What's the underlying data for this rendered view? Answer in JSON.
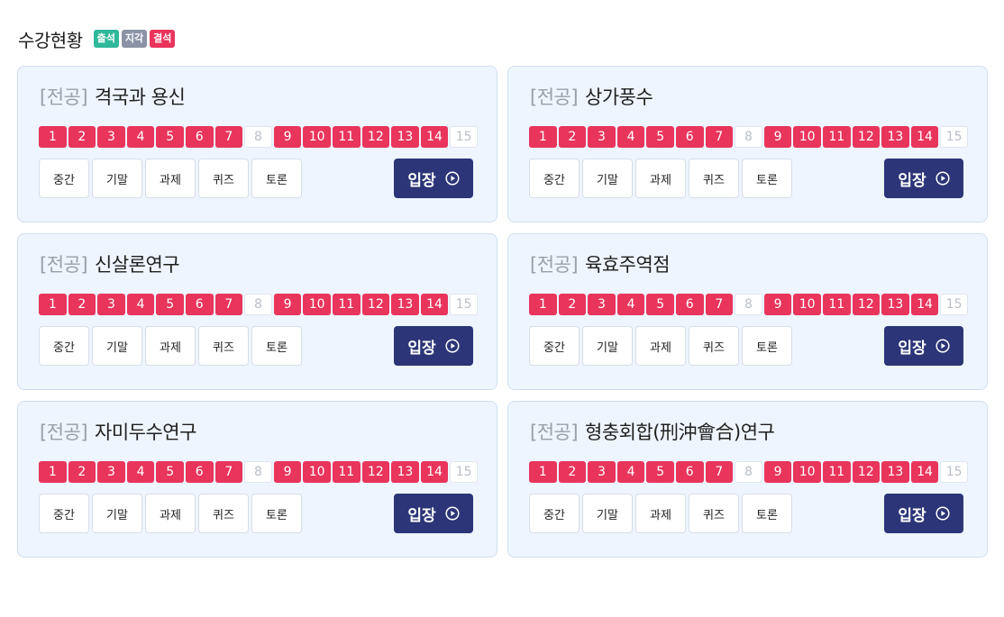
{
  "header": {
    "title": "수강현황",
    "legend": [
      {
        "label": "출석",
        "color": "#2fb89a"
      },
      {
        "label": "지각",
        "color": "#8b93a6"
      },
      {
        "label": "결석",
        "color": "#e9345b"
      }
    ]
  },
  "actions": [
    "중간",
    "기말",
    "과제",
    "퀴즈",
    "토론"
  ],
  "enter_label": "입장",
  "weeks": {
    "labels": [
      "1",
      "2",
      "3",
      "4",
      "5",
      "6",
      "7",
      "8",
      "9",
      "10",
      "11",
      "12",
      "13",
      "14",
      "15"
    ],
    "attended": [
      true,
      true,
      true,
      true,
      true,
      true,
      true,
      false,
      true,
      true,
      true,
      true,
      true,
      true,
      false
    ]
  },
  "courses": [
    {
      "category": "[전공]",
      "name": "격국과 용신"
    },
    {
      "category": "[전공]",
      "name": "상가풍수"
    },
    {
      "category": "[전공]",
      "name": "신살론연구"
    },
    {
      "category": "[전공]",
      "name": "육효주역점"
    },
    {
      "category": "[전공]",
      "name": "자미두수연구"
    },
    {
      "category": "[전공]",
      "name": "형충회합(刑沖會合)연구"
    }
  ]
}
